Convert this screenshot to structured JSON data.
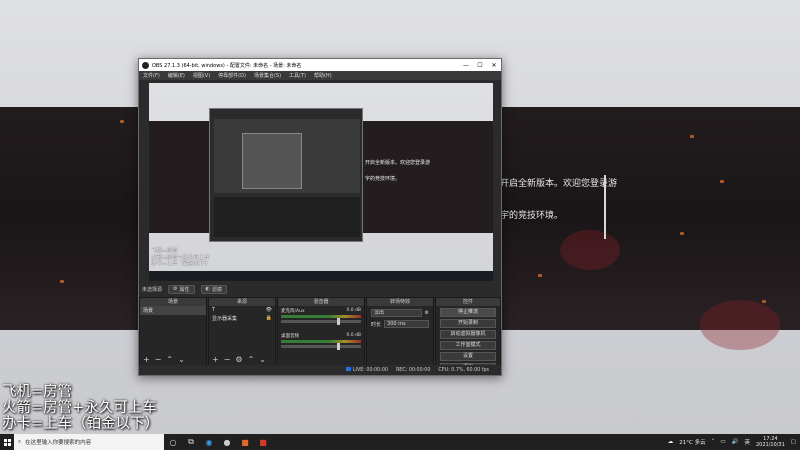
{
  "background": {
    "text_lines": [
      "开启全新版本。欢迎您登录游",
      "宇的竞技环境。"
    ]
  },
  "overlay": {
    "lines": [
      "飞机=房管",
      "火箭=房管+永久可上车",
      "办卡=上车（铂金以下）"
    ]
  },
  "obs": {
    "title": "OBS 27.1.3 (64-bit, windows) - 配置文件: 未命名 - 场景: 未命名",
    "menu": [
      "文件(F)",
      "编辑(E)",
      "视图(V)",
      "停靠部件(D)",
      "场景集合(S)",
      "工具(T)",
      "帮助(H)"
    ],
    "scene_bar": {
      "label": "未选择源",
      "properties_button": "属性",
      "filters_button": "滤镜"
    },
    "scenes": {
      "header": "场景",
      "items": [
        "场景"
      ]
    },
    "sources": {
      "header": "来源",
      "items": [
        "T",
        "显示器采集"
      ]
    },
    "mixer": {
      "header": "混音器",
      "channels": [
        {
          "name": "麦克风/Aux",
          "db": "0.0 dB"
        },
        {
          "name": "桌面音频",
          "db": "0.0 dB"
        }
      ]
    },
    "transitions": {
      "header": "转场特效",
      "type": "淡出",
      "duration_label": "时长",
      "duration_value": "300 ms"
    },
    "controls": {
      "header": "控件",
      "buttons": [
        "停止推流",
        "开始录制",
        "启动虚拟摄像机",
        "工作室模式",
        "设置",
        "退出"
      ]
    },
    "status": {
      "live": "LIVE: 00:00:00",
      "rec": "REC: 00:00:00",
      "cpu": "CPU: 0.7%, 60.00 fps"
    }
  },
  "taskbar": {
    "search_placeholder": "在这里输入你要搜索的内容",
    "weather": "21°C 多云",
    "time": "17:24",
    "date": "2021/10/31"
  },
  "colors": {
    "obs_bg": "#2b2b2b",
    "taskbar": "#202020",
    "dark_band": "#1a1618"
  }
}
